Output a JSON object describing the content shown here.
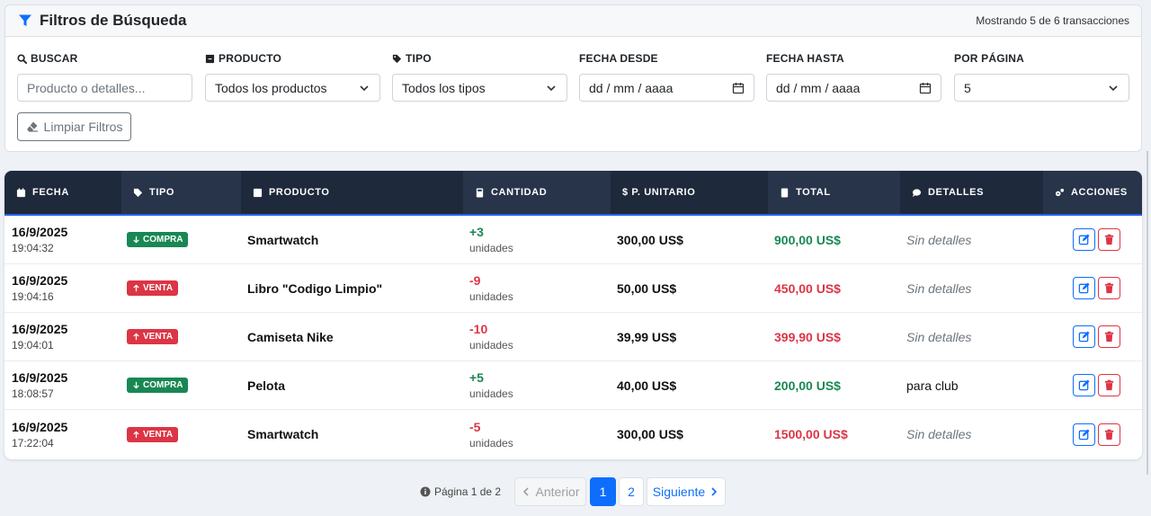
{
  "filters": {
    "title": "Filtros de Búsqueda",
    "count_text": "Mostrando 5 de 6 transacciones",
    "search": {
      "label": "BUSCAR",
      "placeholder": "Producto o detalles..."
    },
    "product": {
      "label": "PRODUCTO",
      "value": "Todos los productos"
    },
    "type": {
      "label": "TIPO",
      "value": "Todos los tipos"
    },
    "date_from": {
      "label": "FECHA DESDE",
      "value": "dd / mm / aaaa"
    },
    "date_to": {
      "label": "FECHA HASTA",
      "value": "dd / mm / aaaa"
    },
    "per_page": {
      "label": "POR PÁGINA",
      "value": "5"
    },
    "clear_label": "Limpiar Filtros"
  },
  "table": {
    "headers": [
      "FECHA",
      "TIPO",
      "PRODUCTO",
      "CANTIDAD",
      "$ P. UNITARIO",
      "TOTAL",
      "DETALLES",
      "ACCIONES"
    ],
    "rows": [
      {
        "date": "16/9/2025",
        "time": "19:04:32",
        "type": "COMPRA",
        "product": "Smartwatch",
        "qty": "+3",
        "unit": "unidades",
        "price": "300,00 US$",
        "total": "900,00 US$",
        "details": "Sin detalles"
      },
      {
        "date": "16/9/2025",
        "time": "19:04:16",
        "type": "VENTA",
        "product": "Libro \"Codigo Limpio\"",
        "qty": "-9",
        "unit": "unidades",
        "price": "50,00 US$",
        "total": "450,00 US$",
        "details": "Sin detalles"
      },
      {
        "date": "16/9/2025",
        "time": "19:04:01",
        "type": "VENTA",
        "product": "Camiseta Nike",
        "qty": "-10",
        "unit": "unidades",
        "price": "39,99 US$",
        "total": "399,90 US$",
        "details": "Sin detalles"
      },
      {
        "date": "16/9/2025",
        "time": "18:08:57",
        "type": "COMPRA",
        "product": "Pelota",
        "qty": "+5",
        "unit": "unidades",
        "price": "40,00 US$",
        "total": "200,00 US$",
        "details": "para club"
      },
      {
        "date": "16/9/2025",
        "time": "17:22:04",
        "type": "VENTA",
        "product": "Smartwatch",
        "qty": "-5",
        "unit": "unidades",
        "price": "300,00 US$",
        "total": "1500,00 US$",
        "details": "Sin detalles"
      }
    ]
  },
  "pagination": {
    "info": "Página 1 de 2",
    "prev_label": "Anterior",
    "page1": "1",
    "page2": "2",
    "next_label": "Siguiente"
  },
  "colors": {
    "header_dark": "#1e293b",
    "header_light": "#27344a",
    "accent": "#0d6efd",
    "compra": "#198754",
    "venta": "#dc3545"
  }
}
